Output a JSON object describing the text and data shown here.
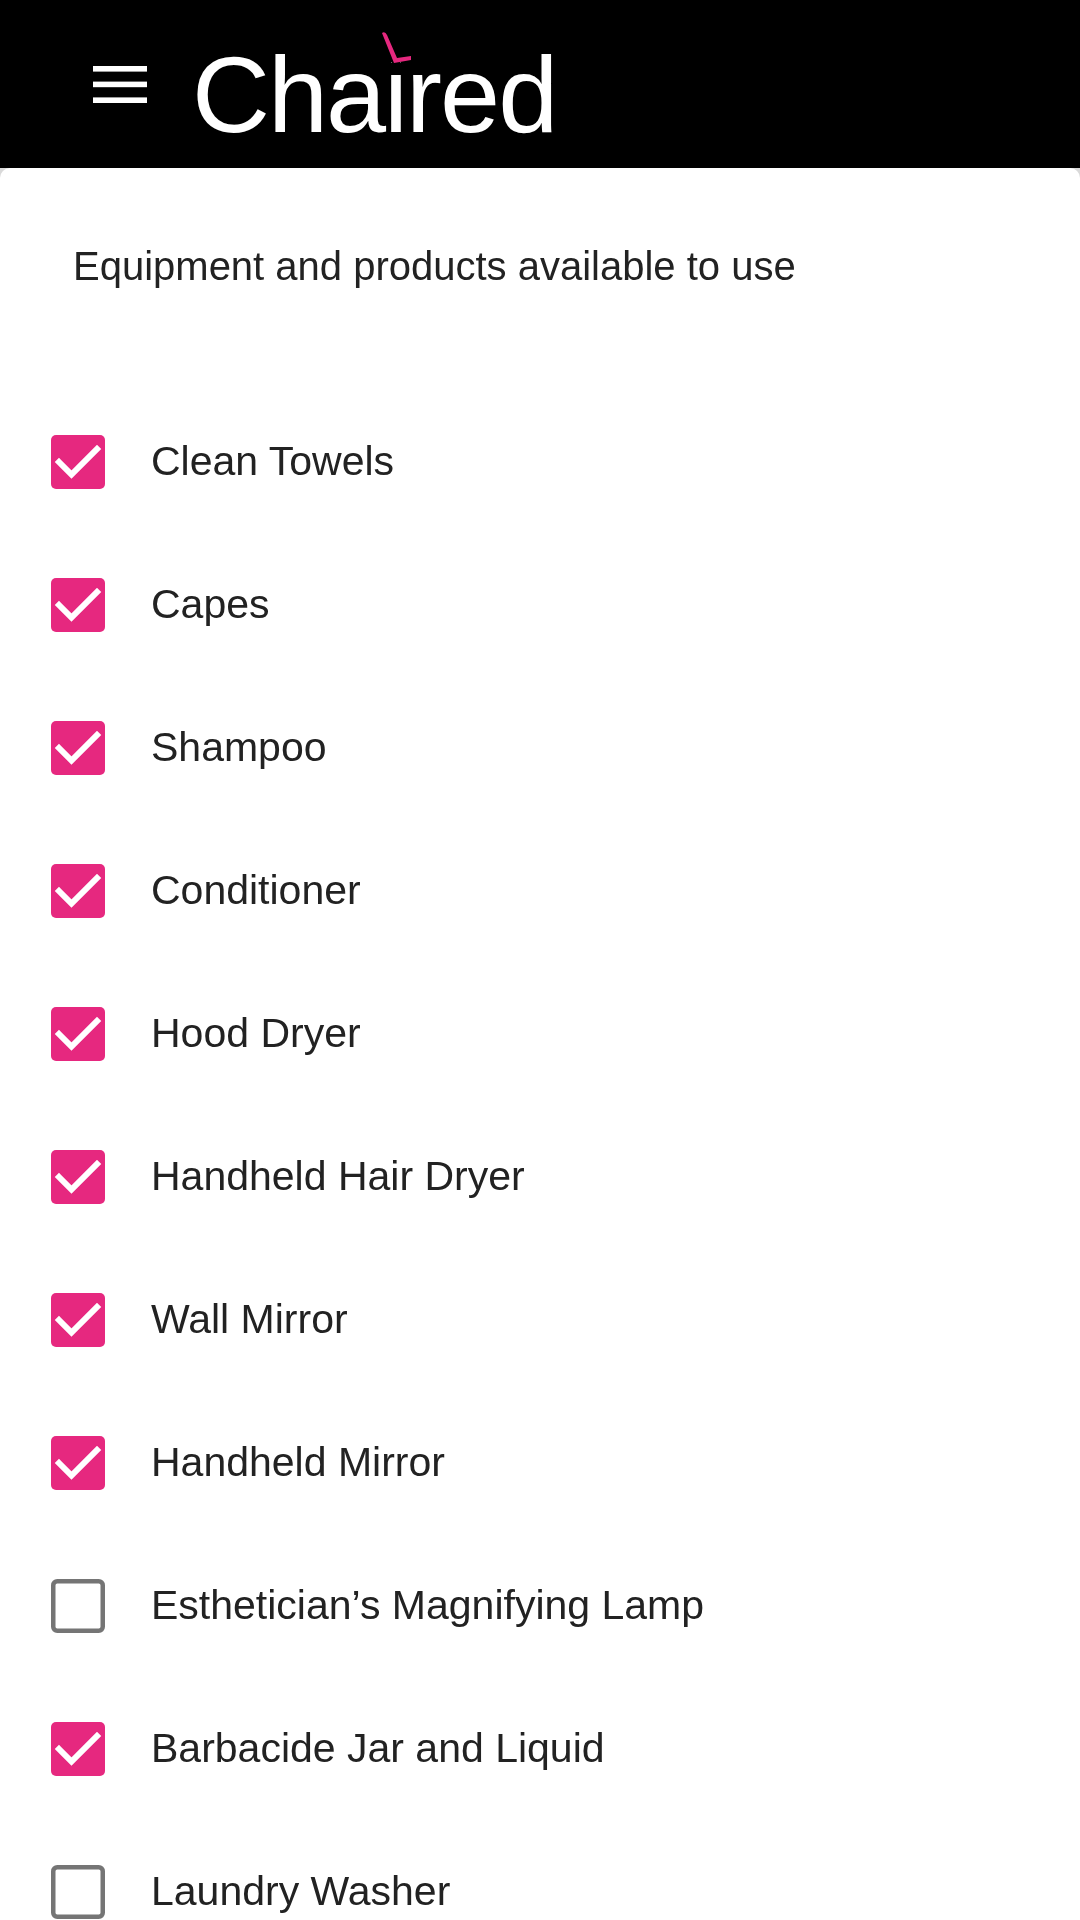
{
  "header": {
    "logo": "Chaired"
  },
  "section": {
    "title": "Equipment and products available to use"
  },
  "items": [
    {
      "label": "Clean Towels",
      "checked": true
    },
    {
      "label": "Capes",
      "checked": true
    },
    {
      "label": "Shampoo",
      "checked": true
    },
    {
      "label": "Conditioner",
      "checked": true
    },
    {
      "label": "Hood Dryer",
      "checked": true
    },
    {
      "label": "Handheld Hair Dryer",
      "checked": true
    },
    {
      "label": "Wall Mirror",
      "checked": true
    },
    {
      "label": "Handheld Mirror",
      "checked": true
    },
    {
      "label": "Esthetician’s Magnifying Lamp",
      "checked": false
    },
    {
      "label": "Barbacide Jar and Liquid",
      "checked": true
    },
    {
      "label": "Laundry Washer",
      "checked": false
    }
  ]
}
